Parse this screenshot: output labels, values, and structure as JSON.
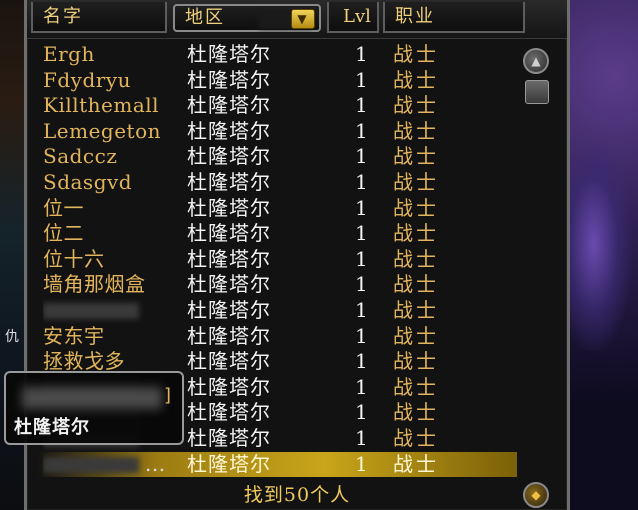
{
  "header": {
    "name_col": "名字",
    "zone_col": "地区",
    "level_col": "Lvl",
    "class_col": "职业",
    "dropdown_icon": "dropdown-arrow-icon"
  },
  "rows": [
    {
      "name": "Ergh",
      "zone": "杜隆塔尔",
      "level": "1",
      "class": "战士"
    },
    {
      "name": "Fdydryu",
      "zone": "杜隆塔尔",
      "level": "1",
      "class": "战士"
    },
    {
      "name": "Killthemall",
      "zone": "杜隆塔尔",
      "level": "1",
      "class": "战士"
    },
    {
      "name": "Lemegeton",
      "zone": "杜隆塔尔",
      "level": "1",
      "class": "战士"
    },
    {
      "name": "Sadccz",
      "zone": "杜隆塔尔",
      "level": "1",
      "class": "战士"
    },
    {
      "name": "Sdasgvd",
      "zone": "杜隆塔尔",
      "level": "1",
      "class": "战士"
    },
    {
      "name": "位一",
      "zone": "杜隆塔尔",
      "level": "1",
      "class": "战士"
    },
    {
      "name": "位二",
      "zone": "杜隆塔尔",
      "level": "1",
      "class": "战士"
    },
    {
      "name": "位十六",
      "zone": "杜隆塔尔",
      "level": "1",
      "class": "战士"
    },
    {
      "name": "墙角那烟盒",
      "zone": "杜隆塔尔",
      "level": "1",
      "class": "战士"
    },
    {
      "name": "",
      "zone": "杜隆塔尔",
      "level": "1",
      "class": "战士"
    },
    {
      "name": "安东宇",
      "zone": "杜隆塔尔",
      "level": "1",
      "class": "战士"
    },
    {
      "name": "拯救戈多",
      "zone": "杜隆塔尔",
      "level": "1",
      "class": "战士"
    },
    {
      "name": "",
      "zone": "杜隆塔尔",
      "level": "1",
      "class": "战士"
    },
    {
      "name": "",
      "zone": "杜隆塔尔",
      "level": "1",
      "class": "战士"
    },
    {
      "name": "",
      "zone": "杜隆塔尔",
      "level": "1",
      "class": "战士"
    },
    {
      "name": "...",
      "zone": "杜隆塔尔",
      "level": "1",
      "class": "战士"
    }
  ],
  "selected_row_index": 16,
  "footer": {
    "result_text": "找到50个人"
  },
  "tooltip": {
    "zone": "杜隆塔尔"
  },
  "colors": {
    "name_gold": "#e2b45b",
    "header_gold": "#f0d07a",
    "selection": "#c9a51a"
  }
}
